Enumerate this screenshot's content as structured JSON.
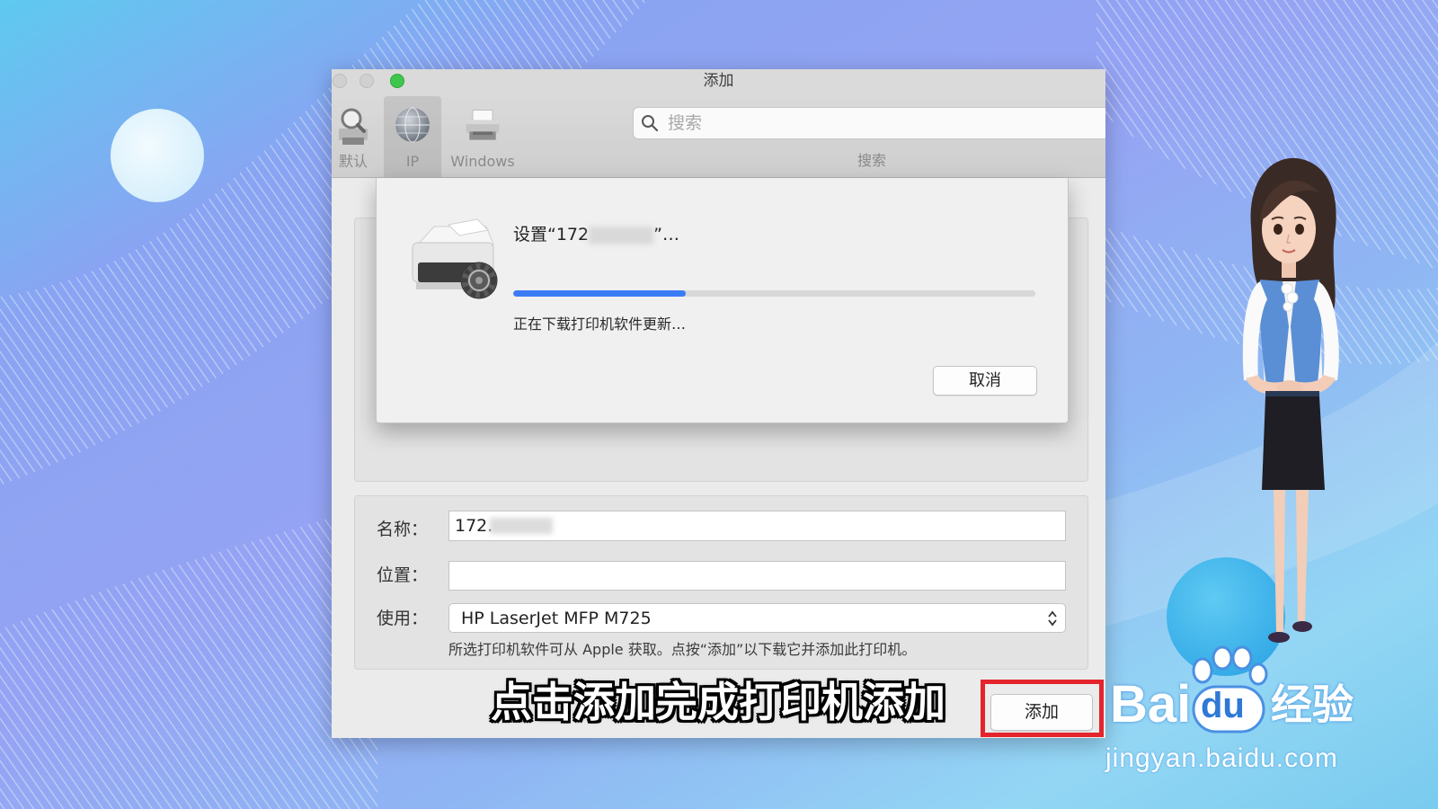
{
  "window": {
    "title": "添加",
    "toolbar": {
      "items": [
        {
          "label": "默认",
          "icon": "default-printers-icon",
          "selected": false
        },
        {
          "label": "IP",
          "icon": "globe-icon",
          "selected": true
        },
        {
          "label": "Windows",
          "icon": "windows-printer-icon",
          "selected": false
        }
      ],
      "search": {
        "placeholder": "搜索",
        "label": "搜索",
        "icon": "search-icon"
      }
    },
    "sheet": {
      "title_prefix": "设置“172",
      "title_suffix": "”…",
      "progress_percent": 33,
      "status": "正在下载打印机软件更新…",
      "cancel_label": "取消",
      "icon": "printer-setup-icon"
    },
    "form": {
      "name_label": "名称：",
      "name_value": "172.",
      "location_label": "位置：",
      "location_value": "",
      "use_label": "使用：",
      "use_value": "HP LaserJet MFP M725",
      "hint": "所选打印机软件可从 Apple 获取。点按“添加”以下载它并添加此打印机。"
    },
    "add_label": "添加"
  },
  "caption": "点击添加完成打印机添加",
  "watermark": {
    "logo_part1": "Bai",
    "logo_part2": "du",
    "logo_cn": "经验",
    "url": "jingyan.baidu.com"
  },
  "colors": {
    "accent": "#3b7cf4",
    "highlight": "#e4242c",
    "zoom_button": "#3ec74c"
  }
}
